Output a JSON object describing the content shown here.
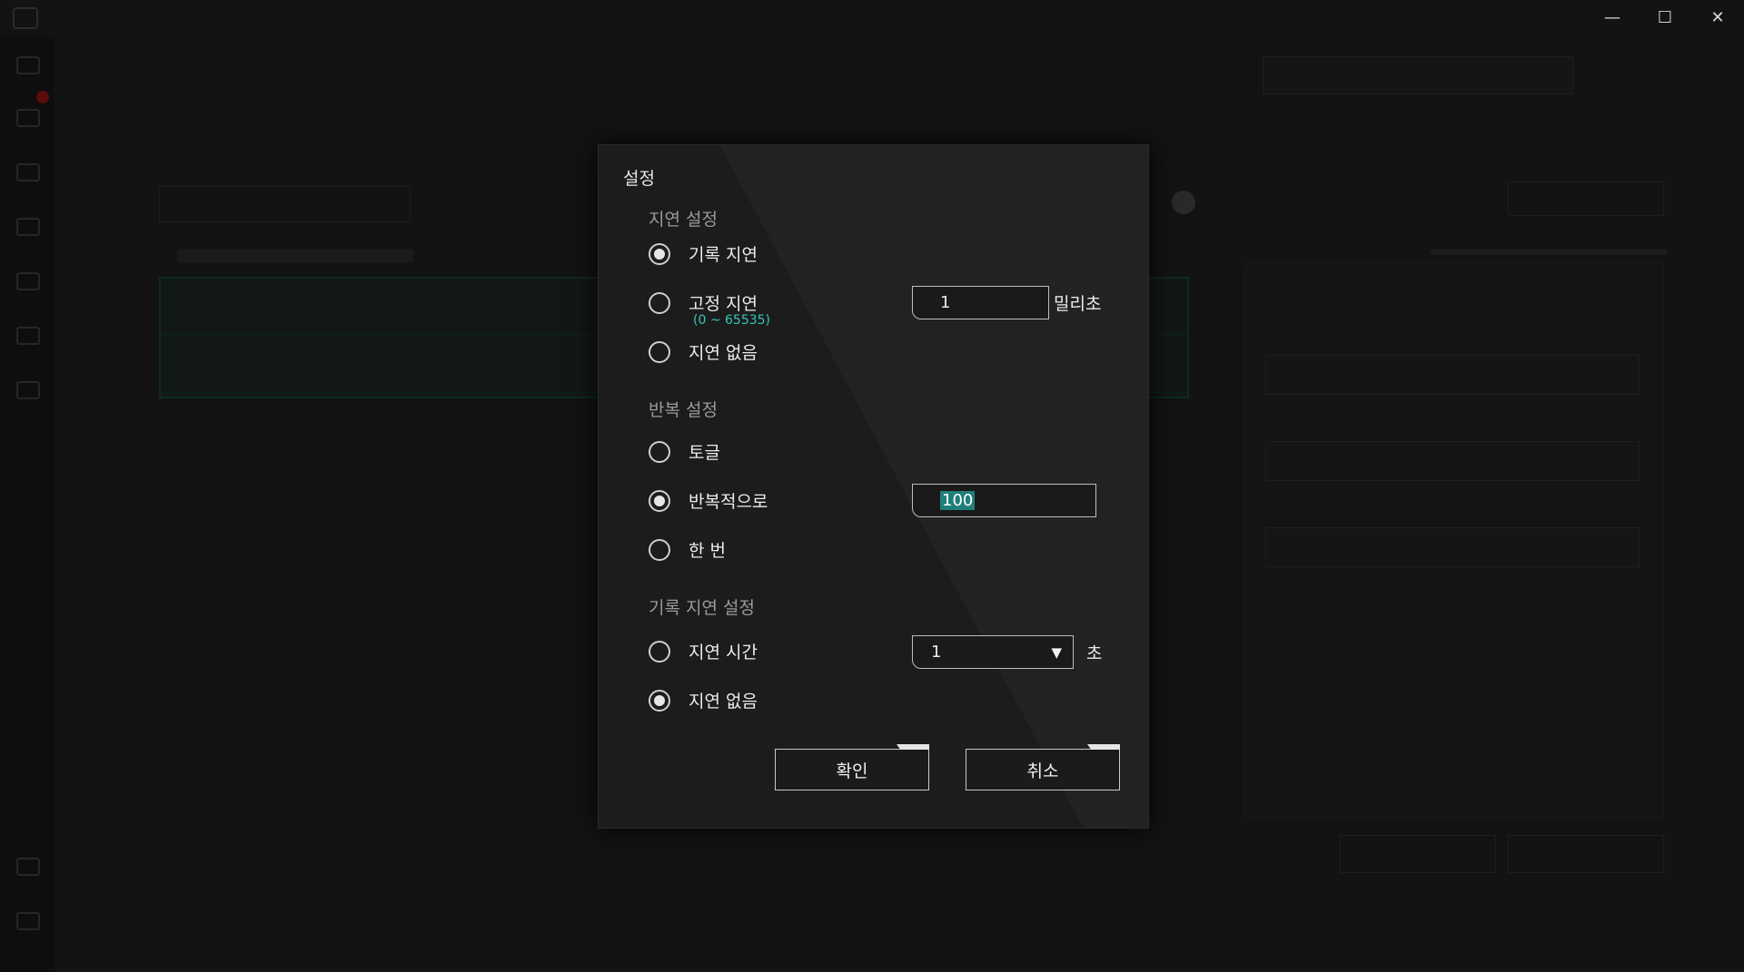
{
  "window": {
    "controls": {
      "minimize": "—",
      "maximize": "☐",
      "close": "✕"
    }
  },
  "dialog": {
    "title": "설정",
    "delay_section": {
      "heading": "지연 설정",
      "options": [
        {
          "label": "기록 지연",
          "selected": true
        },
        {
          "label": "고정 지연",
          "selected": false,
          "hint": "(0 ~ 65535)",
          "value": "1",
          "unit": "밀리초"
        },
        {
          "label": "지연 없음",
          "selected": false
        }
      ]
    },
    "repeat_section": {
      "heading": "반복 설정",
      "options": [
        {
          "label": "토글",
          "selected": false
        },
        {
          "label": "반복적으로",
          "selected": true,
          "value": "100"
        },
        {
          "label": "한 번",
          "selected": false
        }
      ]
    },
    "record_delay_section": {
      "heading": "기록 지연 설정",
      "options": [
        {
          "label": "지연 시간",
          "selected": false,
          "value": "1",
          "unit": "초"
        },
        {
          "label": "지연 없음",
          "selected": true
        }
      ]
    },
    "buttons": {
      "confirm": "확인",
      "cancel": "취소"
    }
  },
  "colors": {
    "accent": "#37c7b8",
    "selection": "#1f7f7b",
    "dialog_bg": "#1c1c1c"
  }
}
